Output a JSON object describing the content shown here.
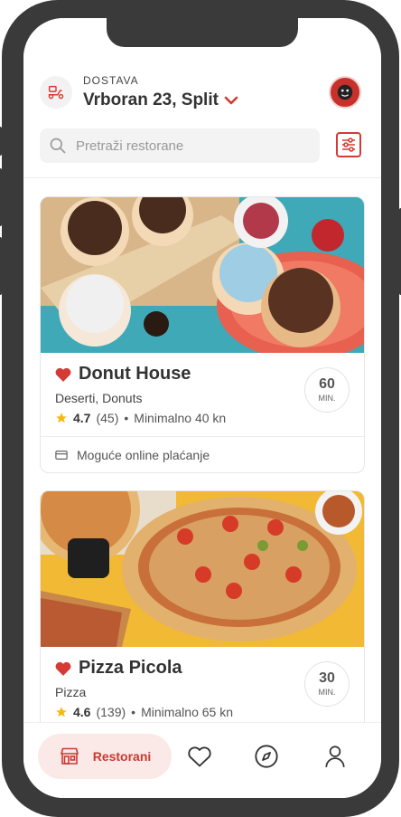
{
  "header": {
    "location_label": "DOSTAVA",
    "address": "Vrboran 23, Split",
    "search_placeholder": "Pretraži restorane"
  },
  "restaurants": [
    {
      "name": "Donut House",
      "categories": "Deserti, Donuts",
      "rating": "4.7",
      "reviews": "(45)",
      "minimum": "Minimalno 40 kn",
      "time_value": "60",
      "time_unit": "MIN.",
      "online_payment": "Moguće online plaćanje",
      "favorite": true
    },
    {
      "name": "Pizza Picola",
      "categories": "Pizza",
      "rating": "4.6",
      "reviews": "(139)",
      "minimum": "Minimalno 65 kn",
      "time_value": "30",
      "time_unit": "MIN.",
      "favorite": true
    }
  ],
  "tabbar": {
    "active_label": "Restorani",
    "items": [
      "restaurants-icon",
      "heart-icon",
      "compass-icon",
      "profile-icon"
    ]
  },
  "colors": {
    "accent": "#d33b34",
    "accent_bg": "#fbe9e7",
    "star": "#f5b90e",
    "frame": "#3a3a3a"
  }
}
